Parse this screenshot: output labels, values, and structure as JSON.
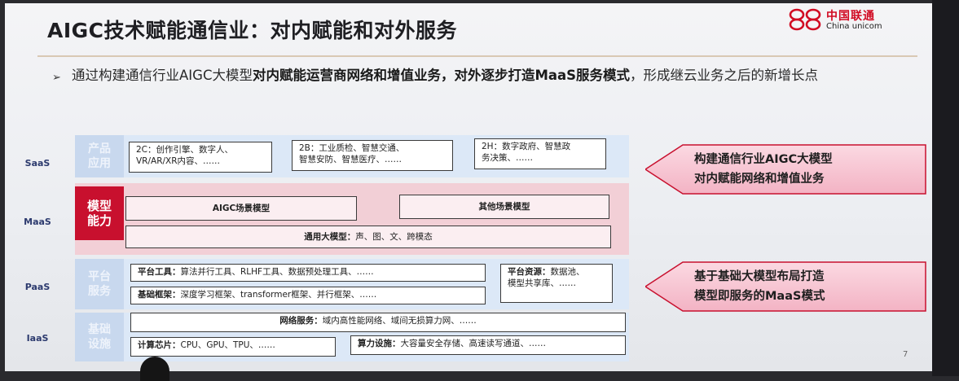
{
  "title": "AIGC技术赋能通信业：对内赋能和对外服务",
  "logo": {
    "cn": "中国联通",
    "en": "China unicom"
  },
  "intro": {
    "part1": "通过构建通信行业AIGC大模型",
    "part2": "对内赋能运营商网络和增值业务，对外逐步打造MaaS服务模式",
    "part3": "，形成继云业务之后的新增长点"
  },
  "layers": [
    "SaaS",
    "MaaS",
    "PaaS",
    "IaaS"
  ],
  "saas": {
    "category": "产品\n应用",
    "b2c": "2C：创作引擎、数字人、\nVR/AR/XR内容、……",
    "b2b": "2B：工业质检、智慧交通、\n智慧安防、智慧医疗、……",
    "b2h": "2H：数字政府、智慧政\n务决策、……"
  },
  "maas": {
    "category": "模型\n能力",
    "aigc": "AIGC场景模型",
    "other": "其他场景模型",
    "general_label": "通用大模型：",
    "general_text": "声、图、文、跨模态"
  },
  "paas": {
    "category": "平台\n服务",
    "tools_label": "平台工具：",
    "tools_text": "算法并行工具、RLHF工具、数据预处理工具、……",
    "framework_label": "基础框架：",
    "framework_text": "深度学习框架、transformer框架、并行框架、……",
    "resources_label": "平台资源：",
    "resources_text": "数据池、\n模型共享库、……"
  },
  "iaas": {
    "category": "基础\n设施",
    "network_label": "网络服务：",
    "network_text": "域内高性能网络、域间无损算力网、……",
    "chips_label": "计算芯片：",
    "chips_text": "CPU、GPU、TPU、……",
    "compute_label": "算力设施：",
    "compute_text": "大容量安全存储、高速读写通道、……"
  },
  "callouts": [
    {
      "line1": "构建通信行业AIGC大模型",
      "line2": "对内赋能网络和增值业务"
    },
    {
      "line1": "基于基础大模型布局打造",
      "line2": "模型即服务的MaaS模式"
    }
  ],
  "page_number": "7",
  "colors": {
    "red": "#c8102e",
    "callout_pink": "#f7c6d2",
    "light_blue": "#dce8f7"
  }
}
